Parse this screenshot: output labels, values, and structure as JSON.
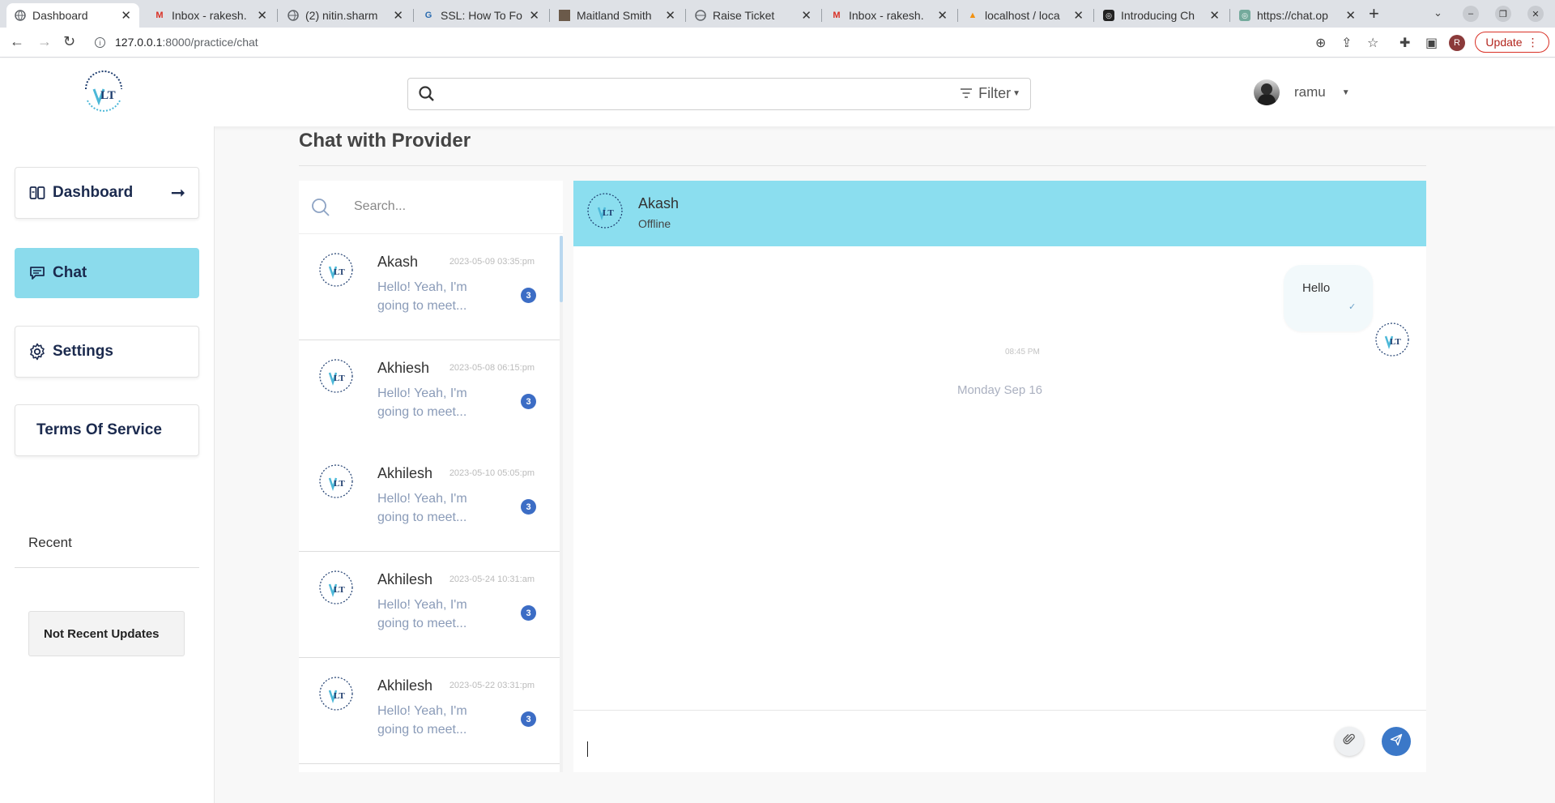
{
  "browser": {
    "tabs": [
      {
        "title": "Dashboard",
        "icon": "globe-icon"
      },
      {
        "title": "Inbox - rakesh.",
        "icon": "gmail-icon"
      },
      {
        "title": "(2) nitin.sharm",
        "icon": "globe-icon"
      },
      {
        "title": "SSL: How To Fo",
        "icon": "site-icon"
      },
      {
        "title": "Maitland Smith",
        "icon": "site-icon"
      },
      {
        "title": "Raise Ticket",
        "icon": "globe-icon"
      },
      {
        "title": "Inbox - rakesh.",
        "icon": "gmail-icon"
      },
      {
        "title": "localhost / loca",
        "icon": "phpmyadmin-icon"
      },
      {
        "title": "Introducing Ch",
        "icon": "openai-icon"
      },
      {
        "title": "https://chat.op",
        "icon": "openai-icon"
      }
    ],
    "url_host": "127.0.0.1",
    "url_path": ":8000/practice/chat",
    "profile_initial": "R",
    "update_label": "Update"
  },
  "header": {
    "search_placeholder": "",
    "filter_label": "Filter",
    "username": "ramu"
  },
  "sidebar": {
    "items": [
      {
        "label": "Dashboard",
        "icon": "dashboard-icon",
        "active": false
      },
      {
        "label": "Chat",
        "icon": "chat-icon",
        "active": true
      },
      {
        "label": "Settings",
        "icon": "gear-icon",
        "active": false
      },
      {
        "label": "Terms Of Service",
        "icon": "",
        "active": false
      }
    ],
    "recent_title": "Recent",
    "recent_empty": "Not Recent Updates"
  },
  "main": {
    "title": "Chat with Provider",
    "contact_search_placeholder": "Search...",
    "contacts": [
      {
        "name": "Akash",
        "date": "2023-05-09 03:35:pm",
        "preview": "Hello! Yeah, I'm going to meet...",
        "unread": "3"
      },
      {
        "name": "Akhiesh",
        "date": "2023-05-08 06:15:pm",
        "preview": "Hello! Yeah, I'm going to meet...",
        "unread": "3"
      },
      {
        "name": "Akhilesh",
        "date": "2023-05-10 05:05:pm",
        "preview": "Hello! Yeah, I'm going to meet...",
        "unread": "3"
      },
      {
        "name": "Akhilesh",
        "date": "2023-05-24 10:31:am",
        "preview": "Hello! Yeah, I'm going to meet...",
        "unread": "3"
      },
      {
        "name": "Akhilesh",
        "date": "2023-05-22 03:31:pm",
        "preview": "Hello! Yeah, I'm going to meet...",
        "unread": "3"
      }
    ],
    "chat": {
      "contact_name": "Akash",
      "contact_status": "Offline",
      "messages": [
        {
          "text": "Hello",
          "time": "08:45 PM",
          "status": "✓"
        }
      ],
      "day_separator": "Monday Sep 16",
      "input_value": ""
    }
  },
  "colors": {
    "accent": "#8bdbec",
    "badge": "#3c6dc5",
    "send": "#3b78c8"
  }
}
